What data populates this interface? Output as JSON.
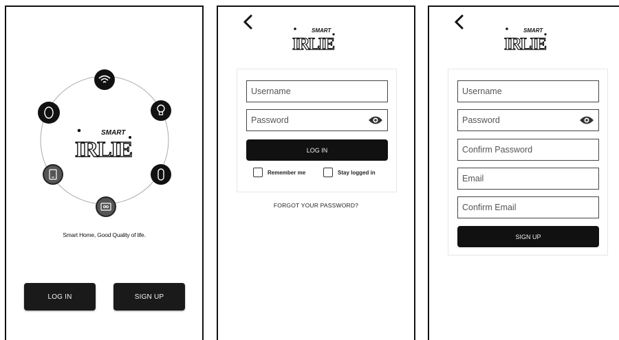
{
  "brand": {
    "word_small": "SMART",
    "word_large": "IRLIE"
  },
  "welcome": {
    "tagline": "Smart Home, Good Quality of life.",
    "login_label": "LOG IN",
    "signup_label": "SIGN UP",
    "ring_icons": [
      "wifi-icon",
      "bulb-icon",
      "remote-icon",
      "tv-icon",
      "phone-icon",
      "oval-device-icon"
    ]
  },
  "login": {
    "username_placeholder": "Username",
    "password_placeholder": "Password",
    "login_label": "LOG IN",
    "remember_label": "Remember me",
    "stay_label": "Stay logged in",
    "forgot_label": "FORGOT YOUR PASSWORD?"
  },
  "signup": {
    "username_placeholder": "Username",
    "password_placeholder": "Password",
    "confirm_password_placeholder": "Confirm Password",
    "email_placeholder": "Email",
    "confirm_email_placeholder": "Confirm Email",
    "signup_label": "SIGN UP"
  }
}
